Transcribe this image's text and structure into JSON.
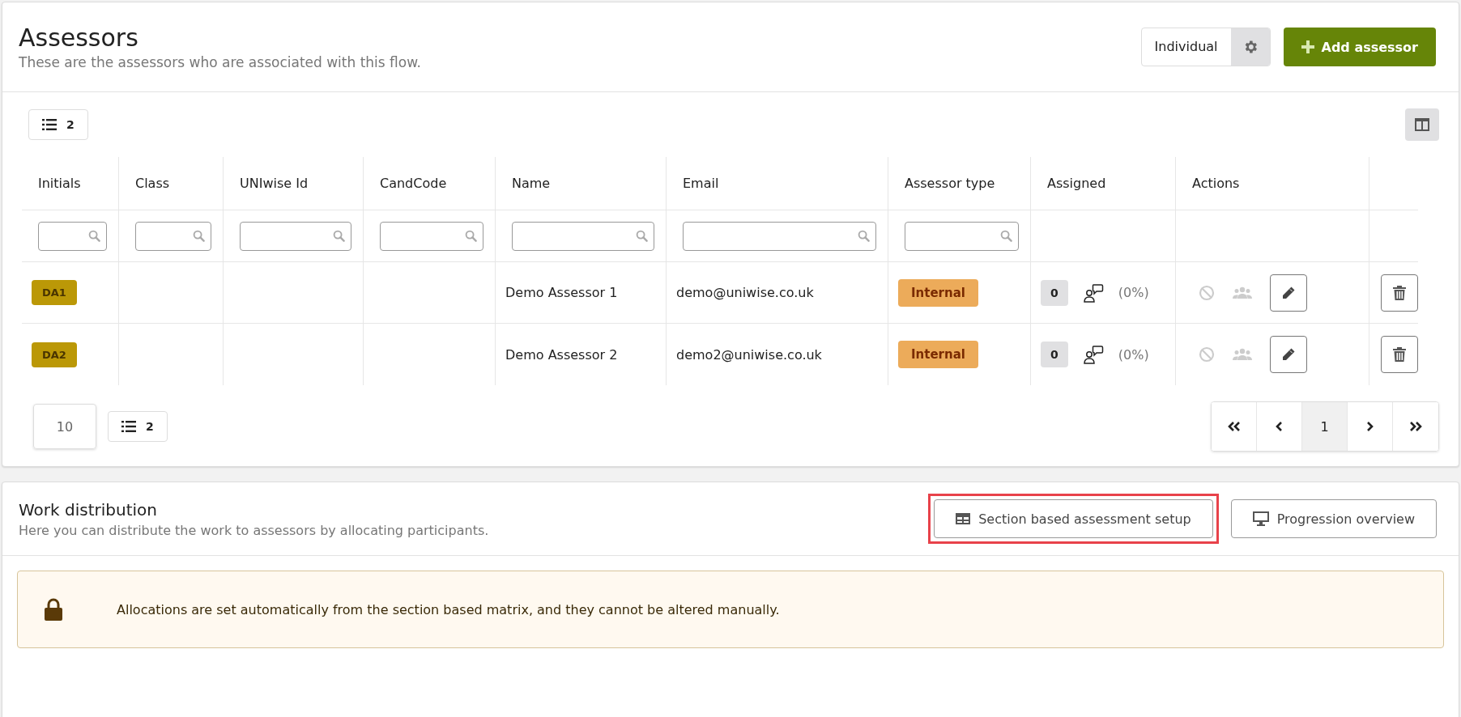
{
  "assessors": {
    "title": "Assessors",
    "subtitle": "These are the assessors who are associated with this flow.",
    "mode_button": "Individual",
    "add_button": "Add assessor"
  },
  "toolbar": {
    "count": "2"
  },
  "table": {
    "columns": [
      {
        "label": "Initials",
        "filter": true
      },
      {
        "label": "Class",
        "filter": true
      },
      {
        "label": "UNIwise Id",
        "filter": true
      },
      {
        "label": "CandCode",
        "filter": true
      },
      {
        "label": "Name",
        "filter": true
      },
      {
        "label": "Email",
        "filter": true
      },
      {
        "label": "Assessor type",
        "filter": true
      },
      {
        "label": "Assigned",
        "filter": false
      },
      {
        "label": "Actions",
        "filter": false
      }
    ],
    "rows": [
      {
        "initials": "DA1",
        "name": "Demo Assessor 1",
        "email": "demo@uniwise.co.uk",
        "type": "Internal",
        "assigned": "0",
        "percent": "(0%)"
      },
      {
        "initials": "DA2",
        "name": "Demo Assessor 2",
        "email": "demo2@uniwise.co.uk",
        "type": "Internal",
        "assigned": "0",
        "percent": "(0%)"
      }
    ]
  },
  "footer": {
    "page_size": "10",
    "count": "2",
    "pages": [
      {
        "kind": "first",
        "selected": false
      },
      {
        "kind": "prev",
        "selected": false
      },
      {
        "kind": "page",
        "label": "1",
        "selected": true
      },
      {
        "kind": "next",
        "selected": false
      },
      {
        "kind": "last",
        "selected": false
      }
    ]
  },
  "work_distribution": {
    "title": "Work distribution",
    "subtitle": "Here you can distribute the work to assessors by allocating participants.",
    "buttons": [
      {
        "kind": "table",
        "label": "Section based assessment setup",
        "highlighted": true
      },
      {
        "kind": "monitor",
        "label": "Progression overview",
        "highlighted": false
      }
    ],
    "notice": "Allocations are set automatically from the section based matrix, and they cannot be altered manually."
  }
}
